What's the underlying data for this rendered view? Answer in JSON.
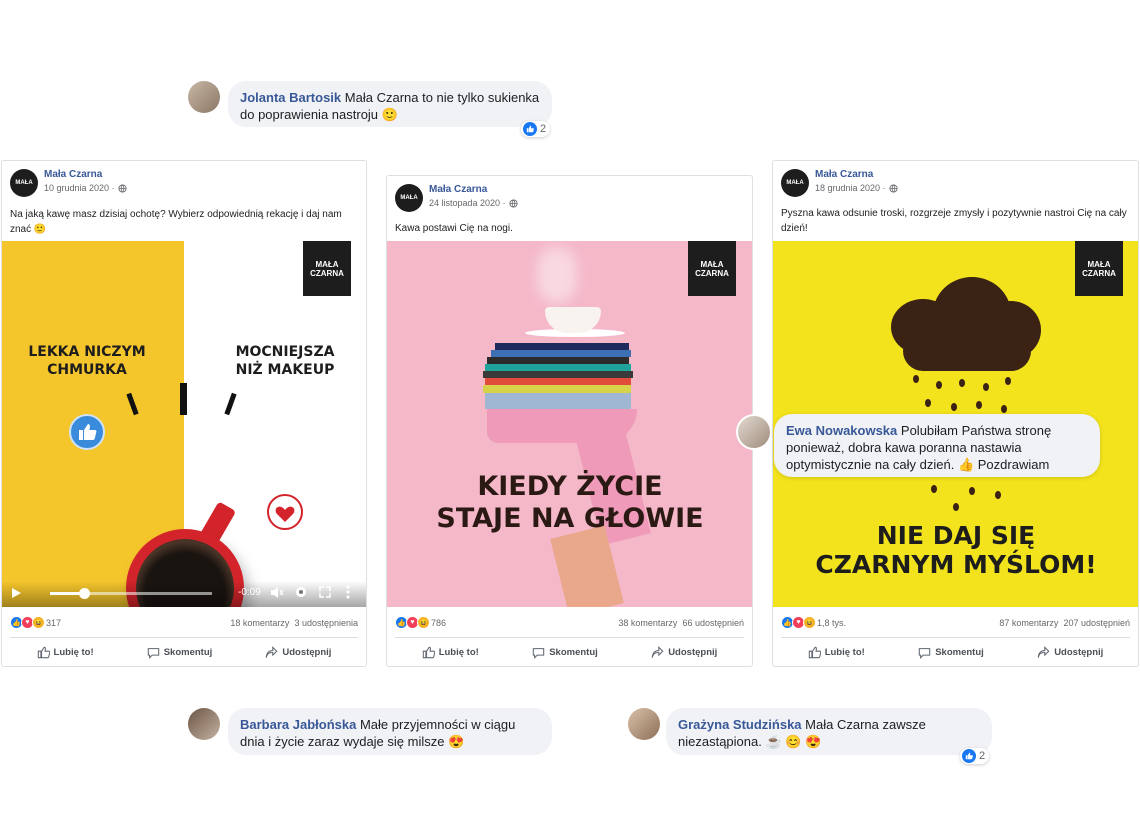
{
  "comments": [
    {
      "author": "Jolanta Bartosik",
      "text": "Mała Czarna to nie tylko sukienka do poprawienia nastroju 🙂",
      "likes": "2"
    },
    {
      "author": "Ewa Nowakowska",
      "text": "Polubiłam Państwa stronę ponieważ, dobra kawa poranna nastawia optymistycznie na cały dzień. 👍 Pozdrawiam",
      "likes": ""
    },
    {
      "author": "Barbara Jabłońska",
      "text": "Małe przyjemności w ciągu dnia i życie zaraz wydaje się milsze 😍",
      "likes": ""
    },
    {
      "author": "Grażyna Studzińska",
      "text": "Mała Czarna zawsze niezastąpiona. ☕ 😊 😍",
      "likes": "2"
    }
  ],
  "brand": {
    "logo_line1": "MAŁA",
    "logo_line2": "CZARNA"
  },
  "posts": [
    {
      "page": "Mała Czarna",
      "date": "10 grudnia 2020 ·",
      "text": "Na jaką kawę masz dzisiaj ochotę? Wybierz odpowiednią rekację i daj nam znać 🙂",
      "poster_left": "LEKKA NICZYM CHMURKA",
      "poster_right": "MOCNIEJSZA NIŻ MAKEUP",
      "video_time": "-0:09",
      "reactions": "317",
      "comments": "18 komentarzy",
      "shares": "3 udostępnienia",
      "like": "Lubię to!",
      "comment": "Skomentuj",
      "share": "Udostępnij"
    },
    {
      "page": "Mała Czarna",
      "date": "24 listopada 2020 ·",
      "text": "Kawa postawi Cię na nogi.",
      "poster_line1": "KIEDY ŻYCIE",
      "poster_line2": "STAJE NA GŁOWIE",
      "reactions": "786",
      "comments": "38 komentarzy",
      "shares": "66 udostępnień",
      "like": "Lubię to!",
      "comment": "Skomentuj",
      "share": "Udostępnij"
    },
    {
      "page": "Mała Czarna",
      "date": "18 grudnia 2020 ·",
      "text": "Pyszna kawa odsunie troski, rozgrzeje zmysły i pozytywnie nastroi Cię na cały dzień!",
      "poster_line1": "NIE DAJ SIĘ",
      "poster_line2": "CZARNYM MYŚLOM!",
      "reactions": "1,8 tys.",
      "comments": "87 komentarzy",
      "shares": "207 udostępnień",
      "like": "Lubię to!",
      "comment": "Skomentuj",
      "share": "Udostępnij"
    }
  ],
  "colors": {
    "fb_blue": "#1877f2",
    "link": "#385898",
    "post1_yellow": "#f5c52c",
    "post2_pink": "#f4b8c9",
    "post3_yellow": "#f3e31c"
  },
  "icons": [
    "like-icon",
    "love-icon",
    "haha-icon",
    "globe-icon",
    "play-icon",
    "volume-icon",
    "settings-icon",
    "fullscreen-icon",
    "more-icon",
    "comment-icon",
    "share-icon"
  ]
}
